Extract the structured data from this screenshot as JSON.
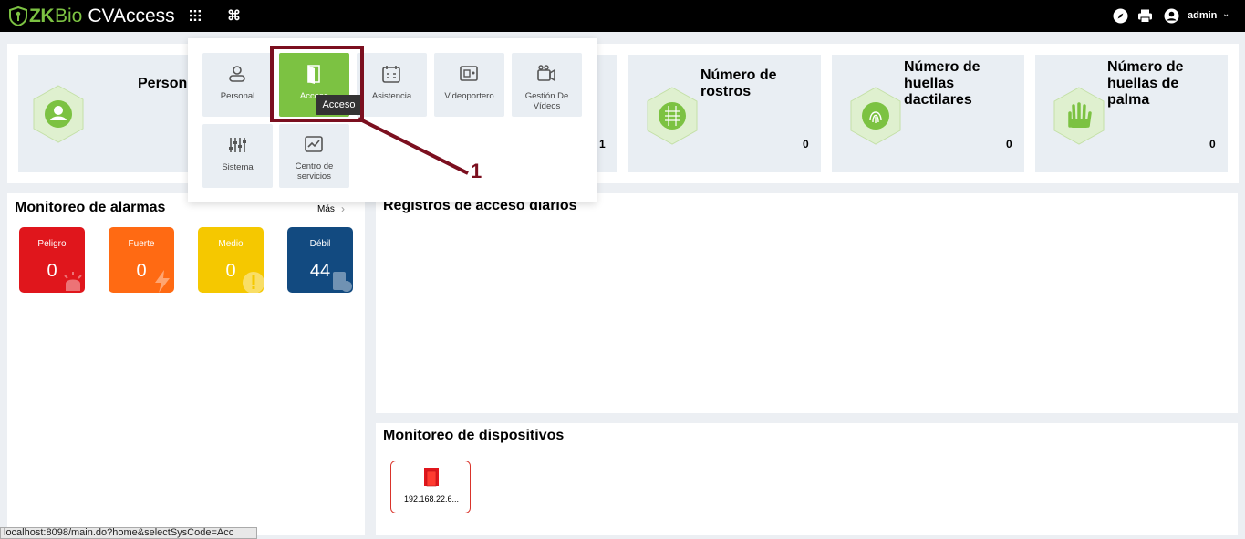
{
  "app": {
    "logo_zk": "ZK",
    "logo_bio": "Bio",
    "logo_product": "CVAccess",
    "apps_icon": "grid-icon",
    "command_icon": "⌘",
    "user_name": "admin"
  },
  "stats": [
    {
      "title": "Person",
      "value": ""
    },
    {
      "title": "",
      "value": "1"
    },
    {
      "title": "Número de rostros",
      "value": "0"
    },
    {
      "title": "Número de huellas dactilares",
      "value": "0"
    },
    {
      "title": "Número de huellas de palma",
      "value": "0"
    }
  ],
  "alarm_panel": {
    "title": "Monitoreo de alarmas",
    "more": "Más",
    "cards": [
      {
        "label": "Peligro",
        "value": "0",
        "color": "#e0161c"
      },
      {
        "label": "Fuerte",
        "value": "0",
        "color": "#ff6a13"
      },
      {
        "label": "Medio",
        "value": "0",
        "color": "#f5c800"
      },
      {
        "label": "Débil",
        "value": "44",
        "color": "#124a80"
      }
    ]
  },
  "access_panel": {
    "title": "Registros de acceso diarios"
  },
  "device_panel": {
    "title": "Monitoreo de dispositivos",
    "devices": [
      {
        "ip": "192.168.22.6..."
      }
    ]
  },
  "menu": {
    "items": [
      {
        "label": "Personal",
        "icon": "person-icon"
      },
      {
        "label": "Acceso",
        "icon": "door-icon",
        "active": true
      },
      {
        "label": "Asistencia",
        "icon": "calendar-icon"
      },
      {
        "label": "Videoportero",
        "icon": "intercom-icon"
      },
      {
        "label": "Gestión De Vídeos",
        "icon": "video-camera-icon"
      },
      {
        "label": "Sistema",
        "icon": "sliders-icon"
      },
      {
        "label": "Centro de servicios",
        "icon": "chart-icon"
      }
    ],
    "tooltip": "Acceso"
  },
  "annotation": {
    "number": "1"
  },
  "status_url": "localhost:8098/main.do?home&selectSysCode=Acc",
  "colors": {
    "brand_green": "#7cc242",
    "annotation": "#7b0f1f"
  }
}
